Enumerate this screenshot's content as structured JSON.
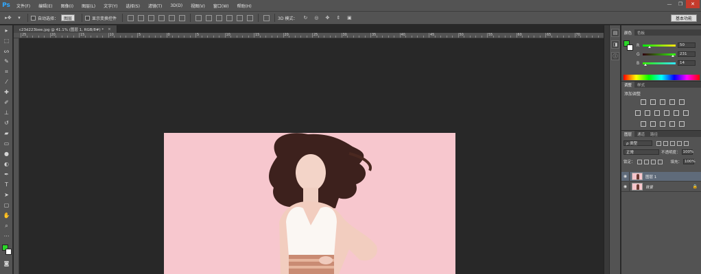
{
  "app": {
    "logo": "Ps"
  },
  "menu": [
    "文件(F)",
    "编辑(E)",
    "图像(I)",
    "图层(L)",
    "文字(Y)",
    "选择(S)",
    "滤镜(T)",
    "3D(D)",
    "视图(V)",
    "窗口(W)",
    "帮助(H)"
  ],
  "window_controls": {
    "minimize": "—",
    "restore": "❐",
    "close": "✕"
  },
  "options": {
    "auto_select_label": "自动选择：",
    "auto_select_value": "图层",
    "show_transform_label": "显示变换控件",
    "mode_3d_label": "3D 模式：",
    "workspace": "基本功能"
  },
  "document": {
    "tab_title": "c23d223bee.jpg @ 41.1% (图层 1, RGB/8#) *",
    "tab_close": "×"
  },
  "ruler_numbers": [
    "25",
    "20",
    "15",
    "10",
    "5",
    "0",
    "5",
    "10",
    "15",
    "20",
    "25",
    "30",
    "35",
    "40",
    "45",
    "50",
    "55",
    "60",
    "65",
    "70",
    "75"
  ],
  "colors": {
    "foreground": "#2bd629",
    "background": "#ffffff",
    "accent": "#31a8ff"
  },
  "color_panel": {
    "tabs": [
      "颜色",
      "色板"
    ],
    "sliders": [
      {
        "label": "R",
        "value": "50"
      },
      {
        "label": "G",
        "value": "231"
      },
      {
        "label": "B",
        "value": "14"
      }
    ]
  },
  "adjustments_panel": {
    "tabs": [
      "调整",
      "样式"
    ],
    "title": "添加调整"
  },
  "layers_panel": {
    "tabs": [
      "图层",
      "通道",
      "路径"
    ],
    "filter_kind": "ρ 类型",
    "blend_mode": "正常",
    "opacity_label": "不透明度：",
    "opacity_value": "100%",
    "lock_label": "锁定：",
    "fill_label": "填充：",
    "fill_value": "100%",
    "layers": [
      {
        "name": "图层 1"
      },
      {
        "name": "背景"
      }
    ]
  }
}
